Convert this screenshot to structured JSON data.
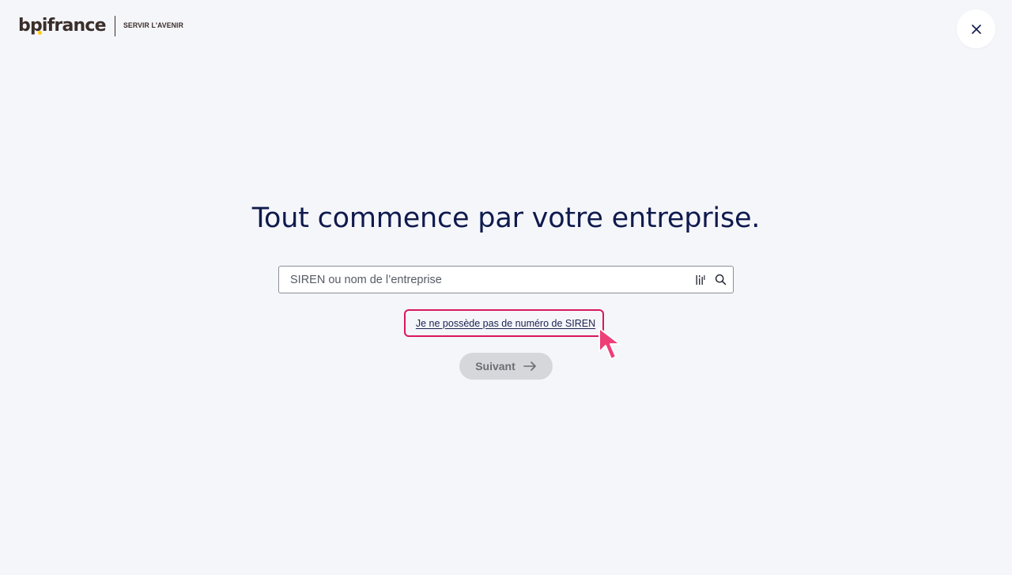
{
  "header": {
    "logo_text": "bpifrance",
    "tagline": "SERVIR L'AVENIR",
    "close_label": "×"
  },
  "main": {
    "title": "Tout commence par votre entreprise.",
    "search": {
      "placeholder": "SIREN ou nom de l’entreprise",
      "value": ""
    },
    "no_siren_link": "Je ne possède pas de numéro de SIREN",
    "next_button": "Suivant"
  },
  "colors": {
    "background": "#f5f6fa",
    "title": "#0f1a4d",
    "highlight": "#d8195a",
    "cursor": "#ee3f78",
    "logo_dot": "#ffcd00"
  },
  "icons": {
    "close": "close-icon",
    "extract": "barcode-icon",
    "search": "search-icon",
    "next": "arrow-right-icon",
    "cursor": "pointer-cursor-icon"
  }
}
